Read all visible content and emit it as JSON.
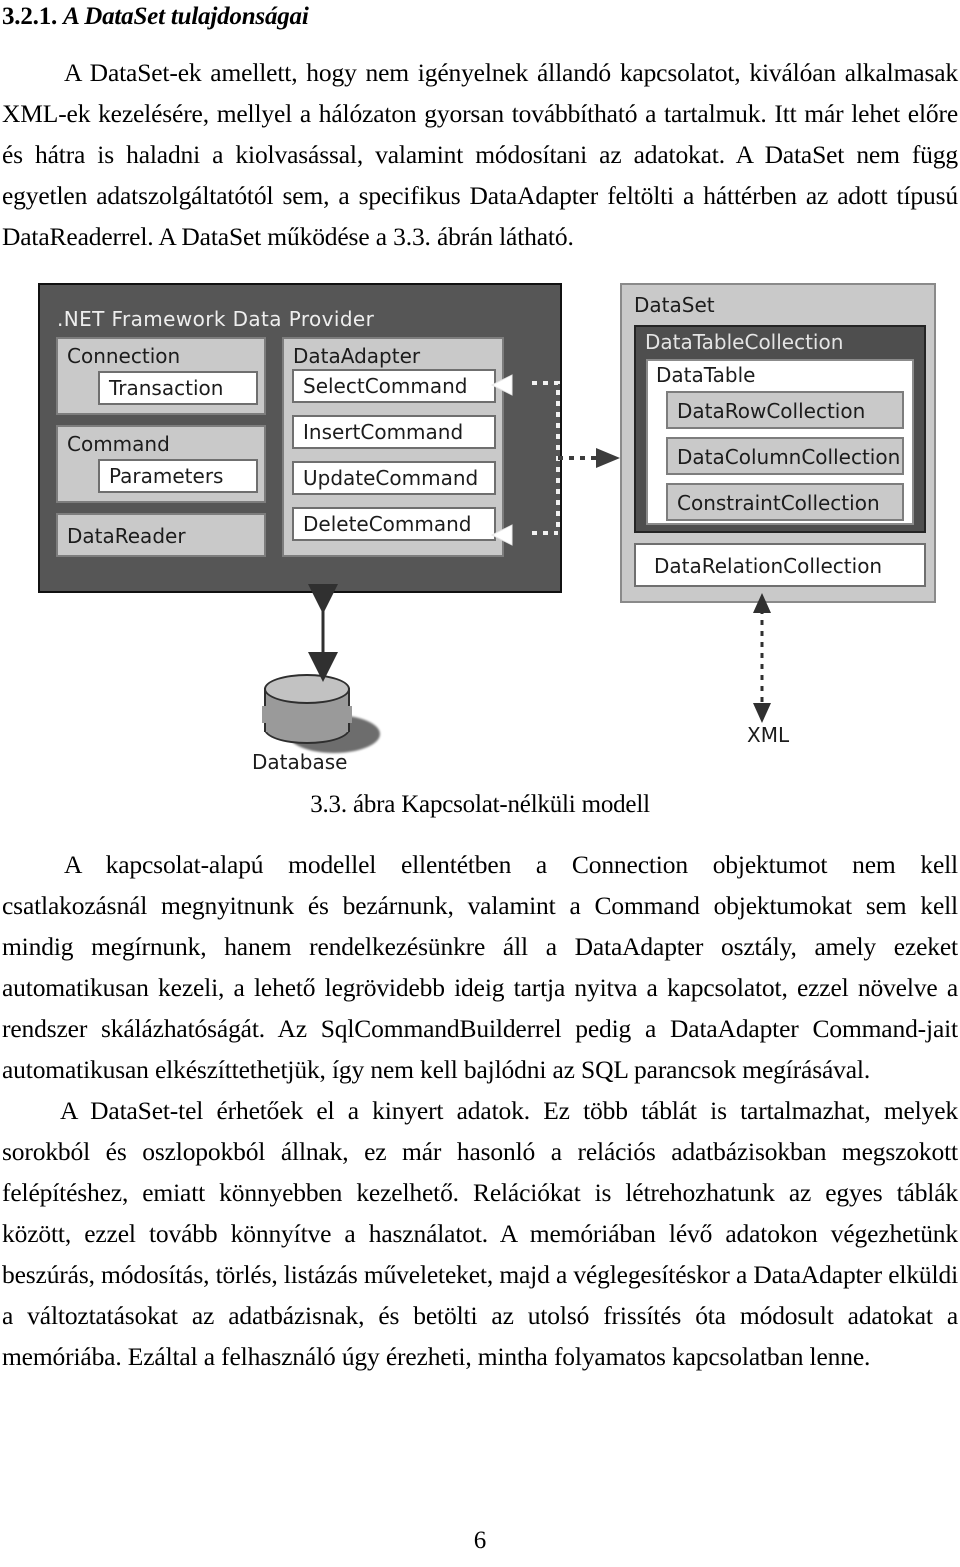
{
  "heading": {
    "number": "3.2.1.",
    "title": "A DataSet tulajdonságai"
  },
  "paragraphs": {
    "p1": "A DataSet-ek amellett, hogy nem igényelnek állandó kapcsolatot, kiválóan alkalmasak XML-ek kezelésére, mellyel a hálózaton gyorsan továbbítható a tartalmuk. Itt már lehet előre és hátra is haladni a kiolvasással, valamint módosítani az adatokat. A DataSet nem függ egyetlen adatszolgáltatótól sem, a specifikus DataAdapter feltölti a háttérben az adott típusú DataReaderrel. A DataSet működése a 3.3. ábrán látható.",
    "p2": "A kapcsolat-alapú modellel ellentétben a Connection objektumot nem kell csatlakozásnál megnyitnunk és bezárnunk, valamint a Command objektumokat sem kell mindig megírnunk, hanem rendelkezésünkre áll a DataAdapter osztály, amely ezeket automatikusan kezeli, a lehető legrövidebb ideig tartja nyitva a kapcsolatot, ezzel növelve a rendszer skálázhatóságát. Az SqlCommandBuilderrel pedig a DataAdapter Command-jait automatikusan elkészíttethetjük, így nem kell bajlódni az SQL parancsok megírásával.",
    "p3": "A DataSet-tel érhetőek el a kinyert adatok. Ez több táblát is tartalmazhat, melyek sorokból és oszlopokból állnak, ez már hasonló a relációs adatbázisokban megszokott felépítéshez, emiatt könnyebben kezelhető. Relációkat is létrehozhatunk az egyes táblák között, ezzel tovább könnyítve a használatot. A memóriában lévő adatokon végezhetünk beszúrás, módosítás, törlés, listázás műveleteket, majd a véglegesítéskor a DataAdapter elküldi a változtatásokat az adatbázisnak, és betölti az utolsó frissítés óta módosult adatokat a memóriába. Ezáltal a felhasználó úgy érezheti, mintha folyamatos kapcsolatban lenne."
  },
  "figure": {
    "caption": "3.3. ábra Kapcsolat-nélküli modell",
    "provider": {
      "title": ".NET Framework Data Provider",
      "connection": "Connection",
      "transaction": "Transaction",
      "command": "Command",
      "parameters": "Parameters",
      "datareader": "DataReader",
      "dataadapter": "DataAdapter",
      "commands": [
        "SelectCommand",
        "InsertCommand",
        "UpdateCommand",
        "DeleteCommand"
      ]
    },
    "dataset": {
      "title": "DataSet",
      "datatablecollection": "DataTableCollection",
      "datatable": "DataTable",
      "collections": [
        "DataRowCollection",
        "DataColumnCollection",
        "ConstraintCollection"
      ],
      "datarelationcollection": "DataRelationCollection"
    },
    "database_label": "Database",
    "xml_label": "XML"
  },
  "footer": {
    "page_number": "6"
  },
  "colors": {
    "dark_panel": "#565656",
    "mid_panel": "#4e4e4e",
    "light_panel": "#c9c9c9",
    "white_box": "#ffffff",
    "text": "#000000"
  }
}
